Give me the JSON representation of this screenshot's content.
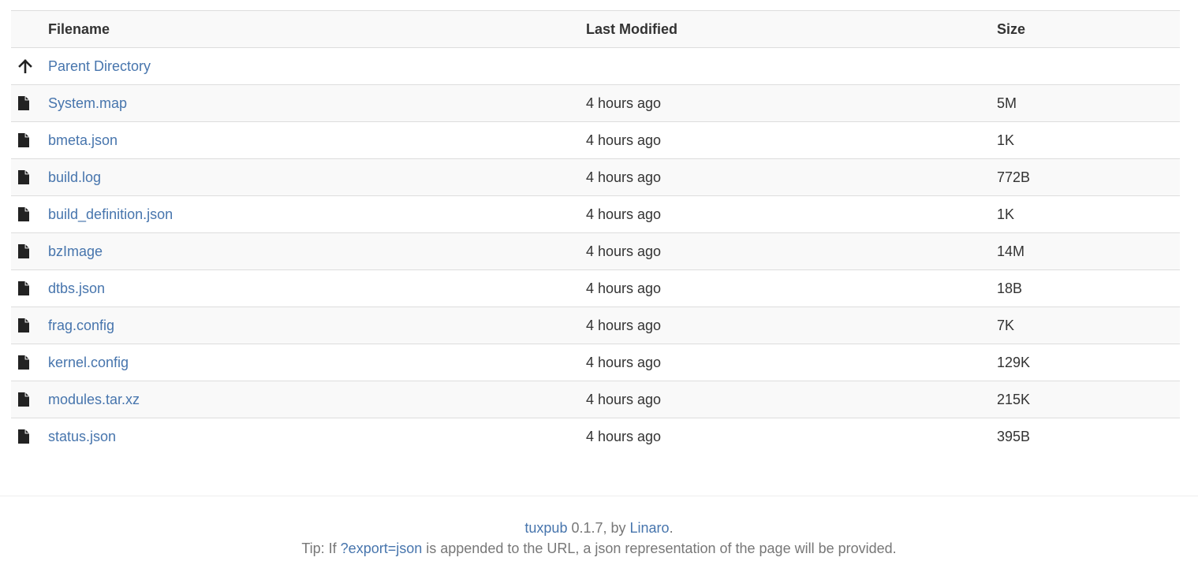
{
  "table": {
    "headers": {
      "filename": "Filename",
      "last_modified": "Last Modified",
      "size": "Size"
    },
    "parent": {
      "label": "Parent Directory",
      "icon": "arrow-up-icon"
    },
    "files": [
      {
        "name": "System.map",
        "modified": "4 hours ago",
        "size": "5M",
        "icon": "file-icon"
      },
      {
        "name": "bmeta.json",
        "modified": "4 hours ago",
        "size": "1K",
        "icon": "file-icon"
      },
      {
        "name": "build.log",
        "modified": "4 hours ago",
        "size": "772B",
        "icon": "file-icon"
      },
      {
        "name": "build_definition.json",
        "modified": "4 hours ago",
        "size": "1K",
        "icon": "file-icon"
      },
      {
        "name": "bzImage",
        "modified": "4 hours ago",
        "size": "14M",
        "icon": "file-icon"
      },
      {
        "name": "dtbs.json",
        "modified": "4 hours ago",
        "size": "18B",
        "icon": "file-icon"
      },
      {
        "name": "frag.config",
        "modified": "4 hours ago",
        "size": "7K",
        "icon": "file-icon"
      },
      {
        "name": "kernel.config",
        "modified": "4 hours ago",
        "size": "129K",
        "icon": "file-icon"
      },
      {
        "name": "modules.tar.xz",
        "modified": "4 hours ago",
        "size": "215K",
        "icon": "file-icon"
      },
      {
        "name": "status.json",
        "modified": "4 hours ago",
        "size": "395B",
        "icon": "file-icon"
      }
    ]
  },
  "footer": {
    "app_link": "tuxpub",
    "version_text": " 0.1.7, by ",
    "author_link": "Linaro",
    "end_period": ".",
    "tip_prefix": "Tip: If ",
    "tip_link": "?export=json",
    "tip_suffix": " is appended to the URL, a json representation of the page will be provided."
  },
  "colors": {
    "link": "#4775ad",
    "text": "#333333",
    "muted": "#777777",
    "stripe": "#f9f9f9",
    "border": "#dddddd"
  }
}
